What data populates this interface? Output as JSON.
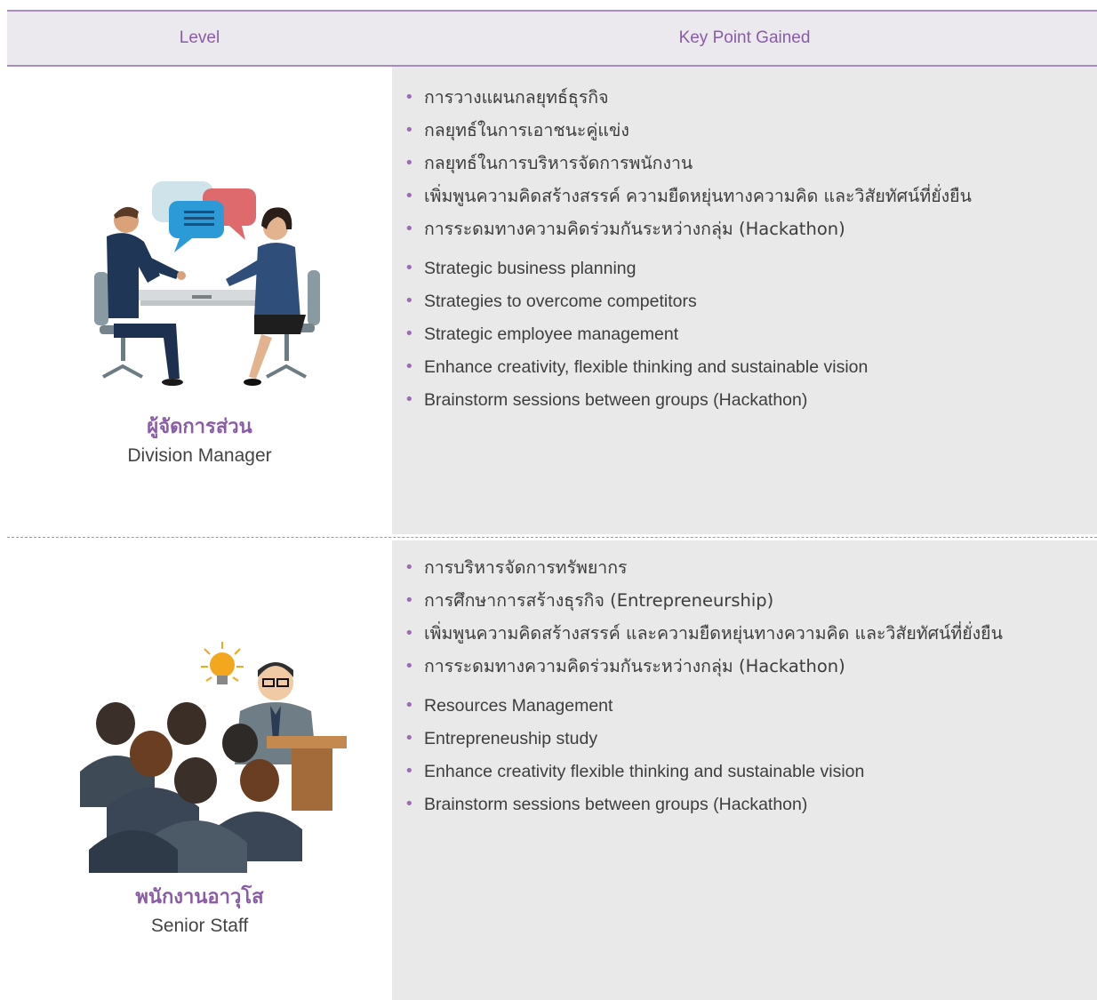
{
  "header": {
    "level_label": "Level",
    "key_point_label": "Key Point Gained"
  },
  "rows": [
    {
      "name_th": "ผู้จัดการส่วน",
      "name_en": "Division Manager",
      "points_th": [
        "การวางแผนกลยุทธ์ธุรกิจ",
        "กลยุทธ์ในการเอาชนะคู่แข่ง",
        "กลยุทธ์ในการบริหารจัดการพนักงาน",
        "เพิ่มพูนความคิดสร้างสรรค์ ความยืดหยุ่นทางความคิด และวิสัยทัศน์ที่ยั่งยืน",
        "การระดมทางความคิดร่วมกันระหว่างกลุ่ม (Hackathon)"
      ],
      "points_en": [
        "Strategic business planning",
        "Strategies to overcome competitors",
        "Strategic employee management",
        "Enhance creativity, flexible thinking and sustainable vision",
        "Brainstorm sessions between groups (Hackathon)"
      ]
    },
    {
      "name_th": "พนักงานอาวุโส",
      "name_en": "Senior Staff",
      "points_th": [
        "การบริหารจัดการทรัพยากร",
        "การศึกษาการสร้างธุรกิจ (Entrepreneurship)",
        "เพิ่มพูนความคิดสร้างสรรค์ และความยืดหยุ่นทางความคิด และวิสัยทัศน์ที่ยั่งยืน",
        "การระดมทางความคิดร่วมกันระหว่างกลุ่ม (Hackathon)"
      ],
      "points_en": [
        "Resources Management",
        "Entrepreneuship study",
        "Enhance creativity flexible thinking and sustainable vision",
        "Brainstorm sessions between groups (Hackathon)"
      ]
    }
  ],
  "colors": {
    "accent": "#8a5ba8",
    "rule": "#a78bc0",
    "header_bg": "#ece9ee",
    "cell_bg": "#e9e9ea"
  },
  "icons": {
    "row1": "business-meeting-illustration",
    "row2": "presentation-audience-illustration"
  }
}
